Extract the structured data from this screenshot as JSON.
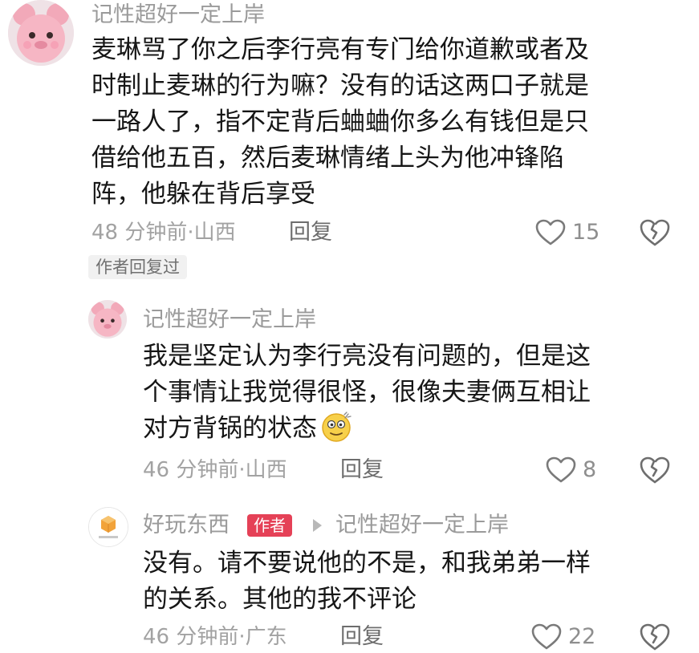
{
  "comments": [
    {
      "username": "记性超好一定上岸",
      "text": "麦琳骂了你之后李行亮有专门给你道歉或者及\n时制止麦琳的行为嘛？没有的话这两口子就是\n一路人了，指不定背后蛐蛐你多么有钱但是只\n借给他五百，然后麦琳情绪上头为他冲锋陷\n阵，他躲在背后享受",
      "meta": "48 分钟前·山西",
      "reply_label": "回复",
      "like_count": "15",
      "tag": "作者回复过",
      "avatar_icon": "pink-bear-avatar"
    },
    {
      "username": "记性超好一定上岸",
      "text": "我是坚定认为李行亮没有问题的，但是这\n个事情让我觉得很怪，很像夫妻俩互相让\n对方背锅的状态",
      "meta": "46 分钟前·山西",
      "reply_label": "回复",
      "like_count": "8",
      "emoji_icon": "dizzy-face-emoji",
      "avatar_icon": "pink-bear-avatar"
    },
    {
      "username": "好玩东西",
      "author_badge": "作者",
      "reply_to": "记性超好一定上岸",
      "text": "没有。请不要说他的不是，和我弟弟一样\n的关系。其他的我不评论",
      "meta": "46 分钟前·广东",
      "reply_label": "回复",
      "like_count": "22",
      "avatar_icon": "orange-box-logo-avatar"
    }
  ],
  "colors": {
    "meta_gray": "#a2a2a2",
    "author_badge_bg": "#e54157"
  }
}
